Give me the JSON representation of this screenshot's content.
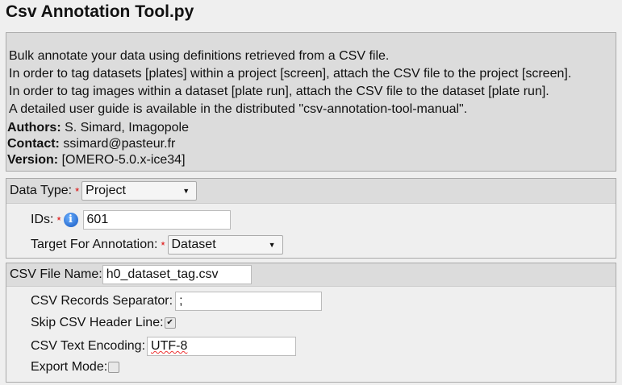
{
  "title": "Csv Annotation Tool.py",
  "intro": {
    "lines": [
      "Bulk annotate your data using definitions retrieved from a CSV file.",
      "In order to tag datasets [plates] within a project [screen], attach the CSV file to the project [screen].",
      "In order to tag images within a dataset [plate run], attach the CSV file to the dataset [plate run].",
      "A detailed user guide is available in the distributed \"csv-annotation-tool-manual\"."
    ],
    "authors_label": "Authors:",
    "authors": "S. Simard, Imagopole",
    "contact_label": "Contact:",
    "contact": "ssimard@pasteur.fr",
    "version_label": "Version:",
    "version": "[OMERO-5.0.x-ice34]"
  },
  "data_type": {
    "label": "Data Type:",
    "required": "*",
    "value": "Project",
    "arrow": "▼"
  },
  "ids": {
    "label": "IDs:",
    "required": "*",
    "info": "i",
    "value": "601"
  },
  "target": {
    "label": "Target For Annotation:",
    "required": "*",
    "value": "Dataset",
    "arrow": "▼"
  },
  "csv": {
    "file_label": "CSV File Name:",
    "file_value": "h0_dataset_tag.csv",
    "sep_label": "CSV Records Separator:",
    "sep_value": ";",
    "skip_label": "Skip CSV Header Line:",
    "skip_checked": true,
    "check": "✔",
    "enc_label": "CSV Text Encoding:",
    "enc_value": "UTF-8",
    "export_label": "Export Mode:",
    "export_checked": false
  }
}
